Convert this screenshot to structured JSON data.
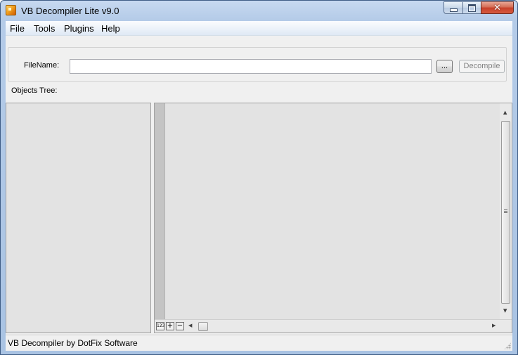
{
  "window": {
    "title": "VB Decompiler Lite v9.0",
    "icon": "app-icon",
    "caption_buttons": {
      "minimize": "minimize-icon",
      "maximize": "maximize-icon",
      "close": "✕"
    }
  },
  "menu": {
    "items": [
      {
        "label": "File"
      },
      {
        "label": "Tools"
      },
      {
        "label": "Plugins"
      },
      {
        "label": "Help"
      }
    ]
  },
  "file_panel": {
    "filename_label": "FileName:",
    "filename_value": "",
    "browse_label": "...",
    "decompile_label": "Decompile"
  },
  "objects_tree": {
    "label": "Objects Tree:"
  },
  "code_view": {
    "toolbar": {
      "numbers_label": "123",
      "zoom_in_label": "+",
      "zoom_out_label": "−"
    }
  },
  "statusbar": {
    "text": "VB Decompiler by DotFix Software"
  },
  "colors": {
    "titlebar": "#b4cbe8",
    "close_button": "#c7402a",
    "pane_background": "#e3e3e3",
    "gutter": "#c4c4c4"
  }
}
